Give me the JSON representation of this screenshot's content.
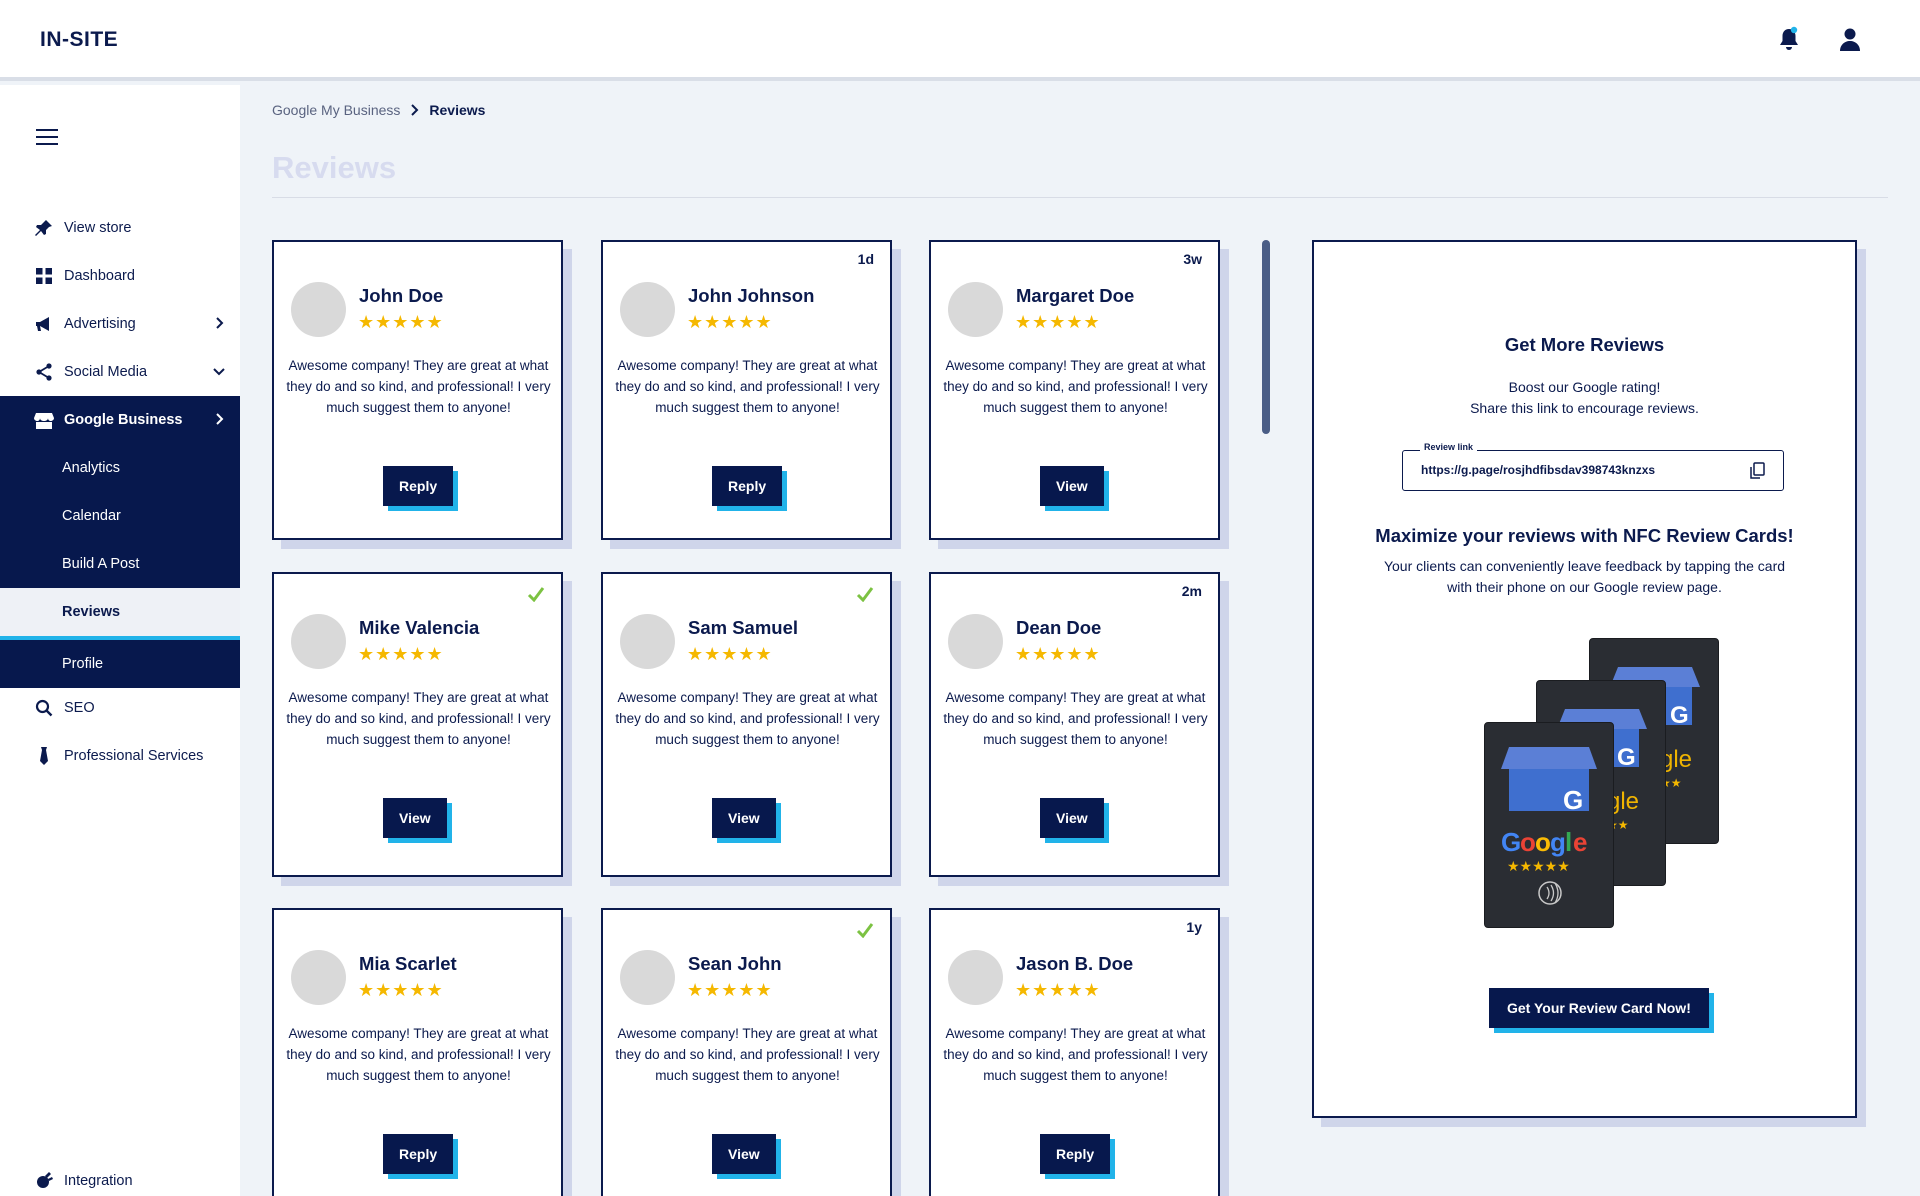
{
  "header": {
    "logo": "IN-SITE",
    "icons": [
      "bell-icon",
      "user-icon"
    ]
  },
  "sidebar": {
    "items": [
      {
        "label": "View store",
        "icon": "pin-icon"
      },
      {
        "label": "Dashboard",
        "icon": "grid-icon"
      },
      {
        "label": "Advertising",
        "icon": "megaphone-icon"
      },
      {
        "label": "Social Media",
        "icon": "share-icon"
      },
      {
        "label": "Google Business",
        "icon": "store-icon"
      },
      {
        "label": "Analytics"
      },
      {
        "label": "Calendar"
      },
      {
        "label": "Build A Post"
      },
      {
        "label": "Reviews"
      },
      {
        "label": "Profile"
      },
      {
        "label": "SEO",
        "icon": "search-icon"
      },
      {
        "label": "Professional Services",
        "icon": "tie-icon"
      },
      {
        "label": "Integration",
        "icon": "plug-icon"
      }
    ]
  },
  "breadcrumb": {
    "parent": "Google My Business",
    "current": "Reviews"
  },
  "page": {
    "title": "Reviews"
  },
  "stars": "★★★★★",
  "reviews": [
    {
      "name": "John Doe",
      "time": "",
      "checked": false,
      "text": "Awesome company! They are great at what they do and so kind, and professional! I very much suggest them to anyone!",
      "button": "Reply"
    },
    {
      "name": "John Johnson",
      "time": "1d",
      "checked": false,
      "text": "Awesome company! They are great at what they do and so kind, and professional! I very much suggest them to anyone!",
      "button": "Reply"
    },
    {
      "name": "Margaret Doe",
      "time": "3w",
      "checked": false,
      "text": "Awesome company! They are great at what they do and so kind, and professional! I very much suggest them to anyone!",
      "button": "View"
    },
    {
      "name": "Mike Valencia",
      "time": "",
      "checked": true,
      "text": "Awesome company! They are great at what they do and so kind, and professional! I very much suggest them to anyone!",
      "button": "View"
    },
    {
      "name": "Sam Samuel",
      "time": "",
      "checked": true,
      "text": "Awesome company! They are great at what they do and so kind, and professional! I very much suggest them to anyone!",
      "button": "View"
    },
    {
      "name": "Dean Doe",
      "time": "2m",
      "checked": false,
      "text": "Awesome company! They are great at what they do and so kind, and professional! I very much suggest them to anyone!",
      "button": "View"
    },
    {
      "name": "Mia Scarlet",
      "time": "",
      "checked": false,
      "text": "Awesome company! They are great at what they do and so kind, and professional! I very much suggest them to anyone!",
      "button": "Reply"
    },
    {
      "name": "Sean John",
      "time": "",
      "checked": true,
      "text": "Awesome company! They are great at what they do and so kind, and professional! I very much suggest them to anyone!",
      "button": "View"
    },
    {
      "name": "Jason B. Doe",
      "time": "1y",
      "checked": false,
      "text": "Awesome company! They are great at what they do and so kind, and professional! I very much suggest them to anyone!",
      "button": "Reply"
    }
  ],
  "panel": {
    "title": "Get More Reviews",
    "subtitle_line1": "Boost our Google rating!",
    "subtitle_line2": "Share this link to encourage reviews.",
    "link_label": "Review link",
    "link_value": "https://g.page/rosjhdfibsdav398743knzxs",
    "nfc_title": "Maximize your reviews with NFC Review Cards!",
    "nfc_text_line1": "Your clients can conveniently leave feedback by tapping the card",
    "nfc_text_line2": "with their phone on our Google review page.",
    "card_brand": "Google",
    "cta": "Get Your Review Card Now!"
  },
  "colors": {
    "navy": "#07184d",
    "accent": "#21b3e9",
    "star": "#f5b800",
    "check": "#7cc242"
  }
}
